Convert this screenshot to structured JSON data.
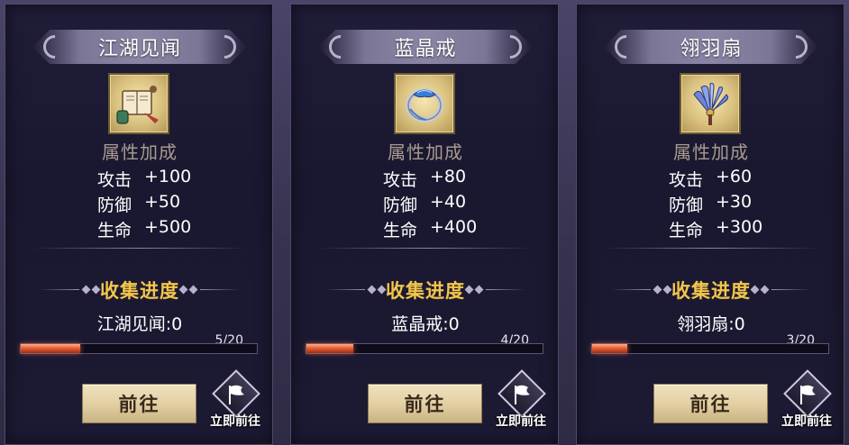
{
  "cards": [
    {
      "title": "江湖见闻",
      "item_icon": "scroll-book-icon",
      "attr_heading": "属性加成",
      "stats": [
        {
          "name": "攻击",
          "value": "+100"
        },
        {
          "name": "防御",
          "value": "+50"
        },
        {
          "name": "生命",
          "value": "+500"
        }
      ],
      "collect_title": "收集进度",
      "collect_count": "江湖见闻:0",
      "progress_text": "5/20",
      "progress_fraction": 0.25,
      "go_label": "前往",
      "teleport_label": "立即前往"
    },
    {
      "title": "蓝晶戒",
      "item_icon": "crystal-ring-icon",
      "attr_heading": "属性加成",
      "stats": [
        {
          "name": "攻击",
          "value": "+80"
        },
        {
          "name": "防御",
          "value": "+40"
        },
        {
          "name": "生命",
          "value": "+400"
        }
      ],
      "collect_title": "收集进度",
      "collect_count": "蓝晶戒:0",
      "progress_text": "4/20",
      "progress_fraction": 0.2,
      "go_label": "前往",
      "teleport_label": "立即前往"
    },
    {
      "title": "翎羽扇",
      "item_icon": "feather-fan-icon",
      "attr_heading": "属性加成",
      "stats": [
        {
          "name": "攻击",
          "value": "+60"
        },
        {
          "name": "防御",
          "value": "+30"
        },
        {
          "name": "生命",
          "value": "+300"
        }
      ],
      "collect_title": "收集进度",
      "collect_count": "翎羽扇:0",
      "progress_text": "3/20",
      "progress_fraction": 0.15,
      "go_label": "前往",
      "teleport_label": "立即前往"
    }
  ],
  "colors": {
    "collect_title": "#f3c64a",
    "attr_heading": "#a89a8e",
    "progress": "#e2582c",
    "button": "#e3d0a4"
  }
}
